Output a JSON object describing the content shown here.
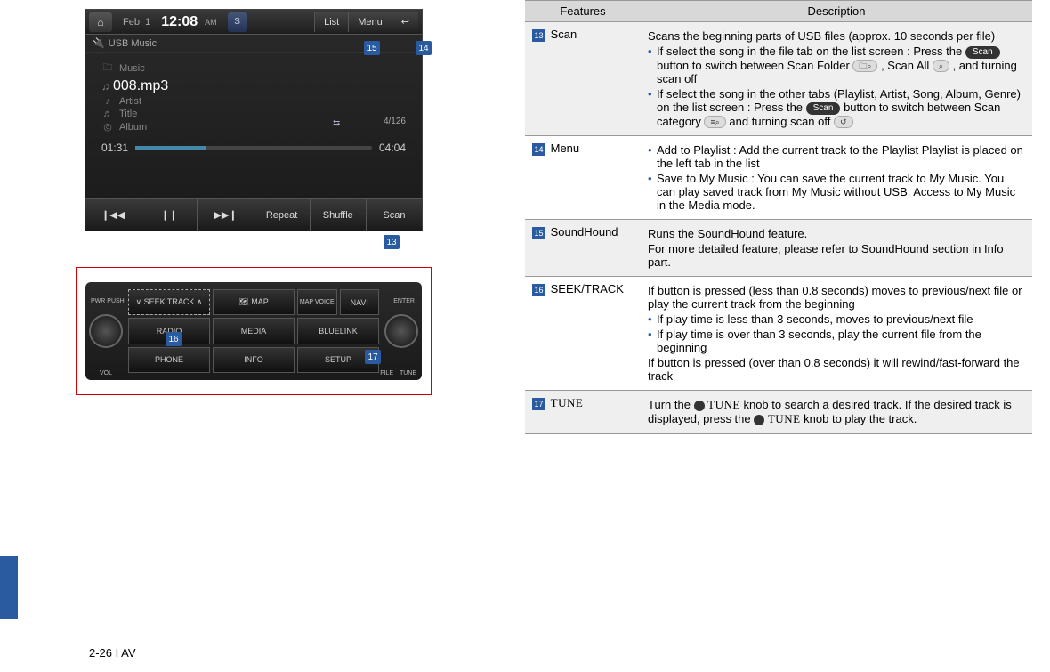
{
  "page_number": "2-26 I AV",
  "screenshot": {
    "status": {
      "date": "Feb.  1",
      "time": "12:08",
      "ampm": "AM"
    },
    "top_buttons": {
      "list": "List",
      "menu": "Menu"
    },
    "source_label": "USB Music",
    "folder": "Music",
    "track_name": "008.mp3",
    "artist_label": "Artist",
    "title_label": "Title",
    "album_label": "Album",
    "elapsed": "01:31",
    "total": "04:04",
    "counter": "4/126",
    "bottom": {
      "prev": "❙◀◀",
      "pause": "❙❙",
      "next": "▶▶❙",
      "repeat": "Repeat",
      "shuffle": "Shuffle",
      "scan": "Scan"
    },
    "callouts": {
      "c13": "13",
      "c14": "14",
      "c15": "15"
    }
  },
  "hardware": {
    "seek": "∨ SEEK    TRACK ∧",
    "map": "🗺 MAP",
    "mapvoice": "MAP VOICE",
    "navi": "NAVI",
    "radio": "RADIO",
    "media": "MEDIA",
    "bluelink": "BLUELINK",
    "phone": "PHONE",
    "info": "INFO",
    "setup": "SETUP",
    "vol_label": "VOL",
    "pwr_label": "PWR PUSH",
    "tune_label": "TUNE",
    "file_label": "FILE",
    "enter_label": "ENTER",
    "callouts": {
      "c16": "16",
      "c17": "17"
    }
  },
  "table": {
    "head": {
      "features": "Features",
      "description": "Description"
    },
    "rows": [
      {
        "num": "13",
        "name": "Scan",
        "alt": true,
        "desc_html": "r0"
      },
      {
        "num": "14",
        "name": "Menu",
        "alt": false,
        "desc_html": "r1"
      },
      {
        "num": "15",
        "name": "SoundHound",
        "alt": true,
        "desc_html": "r2"
      },
      {
        "num": "16",
        "name": "SEEK/TRACK",
        "alt": false,
        "desc_html": "r3"
      },
      {
        "num": "17",
        "name": "TUNE",
        "alt": true,
        "tune_font": true,
        "desc_html": "r4"
      }
    ],
    "desc": {
      "r0": {
        "lead": "Scans the beginning parts of USB files (approx. 10 seconds per file)",
        "b1a": "If select the song in the file tab on the list screen : Press the ",
        "b1_btn": "Scan",
        "b1b": " button to switch between Scan Folder ",
        "b1c": ", Scan All ",
        "b1d": ", and turning scan off",
        "b2a": "If select the song in the other tabs (Playlist, Artist, Song, Album, Genre) on the list screen : Press the ",
        "b2_btn": "Scan",
        "b2b": " button to switch between Scan category ",
        "b2c": " and turning scan off "
      },
      "r1": {
        "b1": "Add to Playlist : Add the current track to the Playlist Playlist is placed on the left tab in the list",
        "b2": "Save to My Music : You can save the current track to My Music. You can play saved track from My Music without USB.  Access to My Music in the Media mode."
      },
      "r2": {
        "p1": "Runs the SoundHound feature.",
        "p2": "For more detailed feature, please refer to SoundHound section in Info part."
      },
      "r3": {
        "p1": "If button is pressed (less than 0.8 seconds) moves to previous/next file or play the current track from the beginning",
        "b1": "If play time is less than 3 seconds, moves to previous/next file",
        "b2": "If play time is over than 3 seconds, play the current file from the beginning",
        "p2": "If button is pressed (over than 0.8 seconds) it will rewind/fast-forward the track"
      },
      "r4": {
        "a": "Turn the ",
        "t1": "TUNE",
        "b": " knob to search a desired track. If the desired track is displayed, press the ",
        "t2": "TUNE",
        "c": " knob to play the track."
      }
    }
  }
}
